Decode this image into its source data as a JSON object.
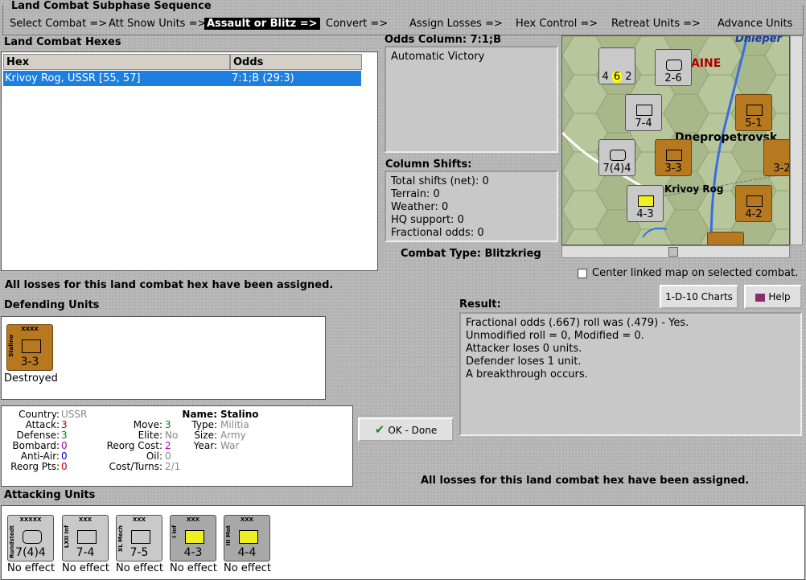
{
  "subphase": {
    "title": "Land Combat Subphase Sequence",
    "phases": [
      "Select Combat =>",
      "Att Snow Units =>",
      "Assault or Blitz =>",
      "Convert =>",
      "Assign Losses =>",
      "Hex Control =>",
      "Retreat Units =>",
      "Advance Units"
    ]
  },
  "combat_hexes": {
    "title": "Land Combat Hexes",
    "col_hex": "Hex",
    "col_odds": "Odds",
    "rows": [
      {
        "hex": "Krivoy Rog, USSR [55, 57]",
        "odds": "7:1;B (29:3)"
      }
    ]
  },
  "odds": {
    "title": "Odds Column: 7:1;B",
    "text": "Automatic Victory"
  },
  "shifts": {
    "title": "Column Shifts:",
    "lines": [
      "Total shifts (net): 0",
      "Terrain: 0",
      "Weather: 0",
      "HQ support: 0",
      "Fractional odds: 0"
    ]
  },
  "combat_type": "Combat Type:  Blitzkrieg",
  "map": {
    "labels": {
      "city1": "Dnepropetrovsk",
      "city2": "Krivoy Rog",
      "river": "Dnieper",
      "region": "AINE"
    },
    "center_checkbox_label": "Center linked map on selected combat."
  },
  "buttons": {
    "charts": "1-D-10 Charts",
    "help": "Help",
    "ok": "OK - Done"
  },
  "losses_msg_top": "All losses for this land combat hex have been assigned.",
  "losses_msg_bottom": "All losses for this land combat hex have been assigned.",
  "defending": {
    "title": "Defending Units",
    "units": [
      {
        "name": "Stalino",
        "size": "XXXX",
        "strength": "3-3",
        "status": "Destroyed"
      }
    ]
  },
  "result": {
    "title": "Result:",
    "lines": [
      "Fractional odds (.667) roll was (.479)  - Yes.",
      "Unmodified roll = 0, Modified = 0.",
      "Attacker loses 0 units.",
      "Defender loses 1 unit.",
      "A breakthrough occurs."
    ]
  },
  "unit_info": {
    "country_label": "Country:",
    "country": "USSR",
    "attack_label": "Attack:",
    "attack": "3",
    "defense_label": "Defense:",
    "defense": "3",
    "bombard_label": "Bombard:",
    "bombard": "0",
    "antiair_label": "Anti-Air:",
    "antiair": "0",
    "reorg_pts_label": "Reorg Pts:",
    "reorg_pts": "0",
    "move_label": "Move:",
    "move": "3",
    "elite_label": "Elite:",
    "elite": "No",
    "reorg_cost_label": "Reorg Cost:",
    "reorg_cost": "2",
    "oil_label": "Oil:",
    "oil": "0",
    "cost_label": "Cost/Turns:",
    "cost": "2/1",
    "name_label": "Name:",
    "name": "Stalino",
    "type_label": "Type:",
    "type": "Militia",
    "size_label": "Size:",
    "size": "Army",
    "year_label": "Year:",
    "year": "War"
  },
  "attacking": {
    "title": "Attacking Units",
    "units": [
      {
        "name": "Rundstedt",
        "size": "XXXXX",
        "strength": "7(4)4",
        "status": "No effect"
      },
      {
        "name": "LXII Inf",
        "size": "XXX",
        "strength": "7-4",
        "status": "No effect"
      },
      {
        "name": "XL Mech",
        "size": "XXX",
        "strength": "7-5",
        "status": "No effect"
      },
      {
        "name": "I Inf",
        "size": "XXX",
        "strength": "4-3",
        "status": "No effect"
      },
      {
        "name": "III Mot",
        "size": "XXX",
        "strength": "4-4",
        "status": "No effect"
      }
    ]
  },
  "colors": {
    "selection": "#1c7ee0",
    "soviet": "#b7791f",
    "axis_grey": "#c9c9c9",
    "stat_red": "#c00000",
    "stat_green": "#008000",
    "stat_purple": "#b000b0",
    "stat_blue": "#0000c0",
    "stat_grey": "#888888"
  }
}
